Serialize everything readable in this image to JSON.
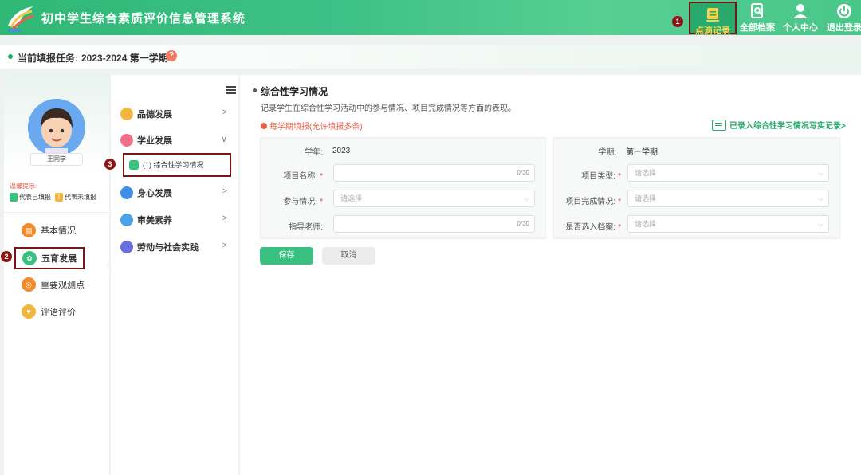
{
  "header": {
    "title": "初中学生综合素质评价信息管理系统",
    "nav": [
      {
        "label": "点滴记录",
        "icon": "note-icon",
        "step": "1"
      },
      {
        "label": "全部档案",
        "icon": "archive-search-icon"
      },
      {
        "label": "个人中心",
        "icon": "user-icon"
      },
      {
        "label": "退出登录",
        "icon": "power-icon"
      }
    ]
  },
  "task": {
    "label": "当前填报任务:",
    "value": "2023-2024 第一学期",
    "help": "?"
  },
  "student": {
    "name": "王同学"
  },
  "tips": {
    "title": "温馨提示:",
    "filled": "代表已填报",
    "unfilled": "代表未填报",
    "unfilled_mark": "!"
  },
  "left_nav": [
    {
      "label": "基本情况",
      "icon": "profile-icon"
    },
    {
      "label": "五育发展",
      "icon": "growth-icon",
      "step": "2"
    },
    {
      "label": "重要观测点",
      "icon": "target-icon"
    },
    {
      "label": "评语评价",
      "icon": "badge-icon"
    }
  ],
  "categories": [
    {
      "label": "品德发展",
      "chev": ">"
    },
    {
      "label": "学业发展",
      "chev": "∨"
    },
    {
      "label": "身心发展",
      "chev": ">"
    },
    {
      "label": "审美素养",
      "chev": ">"
    },
    {
      "label": "劳动与社会实践",
      "chev": ">"
    }
  ],
  "sub_item": {
    "label": "(1) 综合性学习情况",
    "step": "3"
  },
  "section": {
    "title": "综合性学习情况",
    "desc": "记录学生在综合性学习活动中的参与情况、项目完成情况等方面的表现。",
    "notice": "每学期填报(允许填报多条)",
    "record_link": "已录入综合性学习情况写实记录>"
  },
  "form": {
    "year_label": "学年:",
    "year_value": "2023",
    "term_label": "学期:",
    "term_value": "第一学期",
    "project_name_label": "项目名称:",
    "project_name_count": "0/30",
    "project_type_label": "项目类型:",
    "project_type_placeholder": "请选择",
    "participation_label": "参与情况:",
    "participation_placeholder": "请选择",
    "completion_label": "项目完成情况:",
    "completion_placeholder": "请选择",
    "teacher_label": "指导老师:",
    "teacher_count": "0/30",
    "archive_label": "是否选入档案:",
    "archive_placeholder": "请选择",
    "required_mark": "*"
  },
  "buttons": {
    "save": "保存",
    "cancel": "取消"
  },
  "colors": {
    "brand_green": "#3bbf81",
    "header_green": "#2fb876",
    "notice_red": "#e8624a",
    "annotation_red": "#7a1515"
  }
}
